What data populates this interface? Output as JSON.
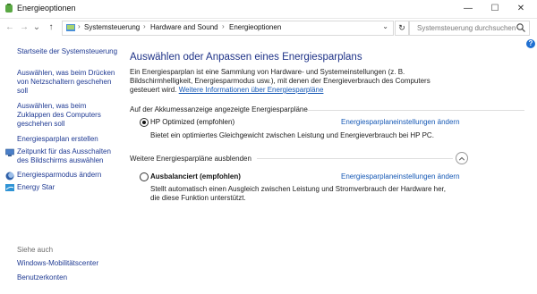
{
  "window": {
    "title": "Energieoptionen",
    "controls": {
      "minimize": "—",
      "maximize": "☐",
      "close": "✕"
    }
  },
  "nav": {
    "back": "←",
    "forward": "→",
    "recent": "⌄",
    "up": "↑",
    "breadcrumbs": [
      "Systemsteuerung",
      "Hardware and Sound",
      "Energieoptionen"
    ],
    "separator": "›",
    "dropdown": "⌄",
    "refresh": "↻",
    "search_placeholder": "Systemsteuerung durchsuchen"
  },
  "sidebar": {
    "home": "Startseite der Systemsteuerung",
    "links": [
      "Auswählen, was beim Drücken von Netzschaltern geschehen soll",
      "Auswählen, was beim Zuklappen des Computers geschehen soll",
      "Energiesparplan erstellen",
      "Zeitpunkt für das Ausschalten des Bildschirms auswählen",
      "Energiesparmodus ändern",
      "Energy Star"
    ],
    "see_also": "Siehe auch",
    "see_also_links": [
      "Windows-Mobilitätscenter",
      "Benutzerkonten"
    ]
  },
  "main": {
    "title": "Auswählen oder Anpassen eines Energiesparplans",
    "intro": "Ein Energiesparplan ist eine Sammlung von Hardware- und Systemeinstellungen (z. B. Bildschirmhelligkeit, Energiesparmodus usw.), mit denen der Energieverbrauch des Computers gesteuert wird.",
    "intro_link": "Weitere Informationen über Energiesparpläne",
    "group1": "Auf der Akkumessanzeige angezeigte Energiesparpläne",
    "plan1": {
      "name": "HP Optimized (empfohlen)",
      "link": "Energiesparplaneinstellungen ändern",
      "desc": "Bietet ein optimiertes Gleichgewicht zwischen Leistung und Energieverbrauch bei HP PC.",
      "selected": true
    },
    "group2": "Weitere Energiesparpläne ausblenden",
    "collapse": "⌃",
    "plan2": {
      "name": "Ausbalanciert (empfohlen)",
      "link": "Energiesparplaneinstellungen ändern",
      "desc": "Stellt automatisch einen Ausgleich zwischen Leistung und Stromverbrauch der Hardware her, die diese Funktion unterstützt.",
      "selected": false
    },
    "help": "?"
  },
  "colors": {
    "link": "#1558b5",
    "title": "#1e3287",
    "sidebar_link": "#1f3a93"
  }
}
